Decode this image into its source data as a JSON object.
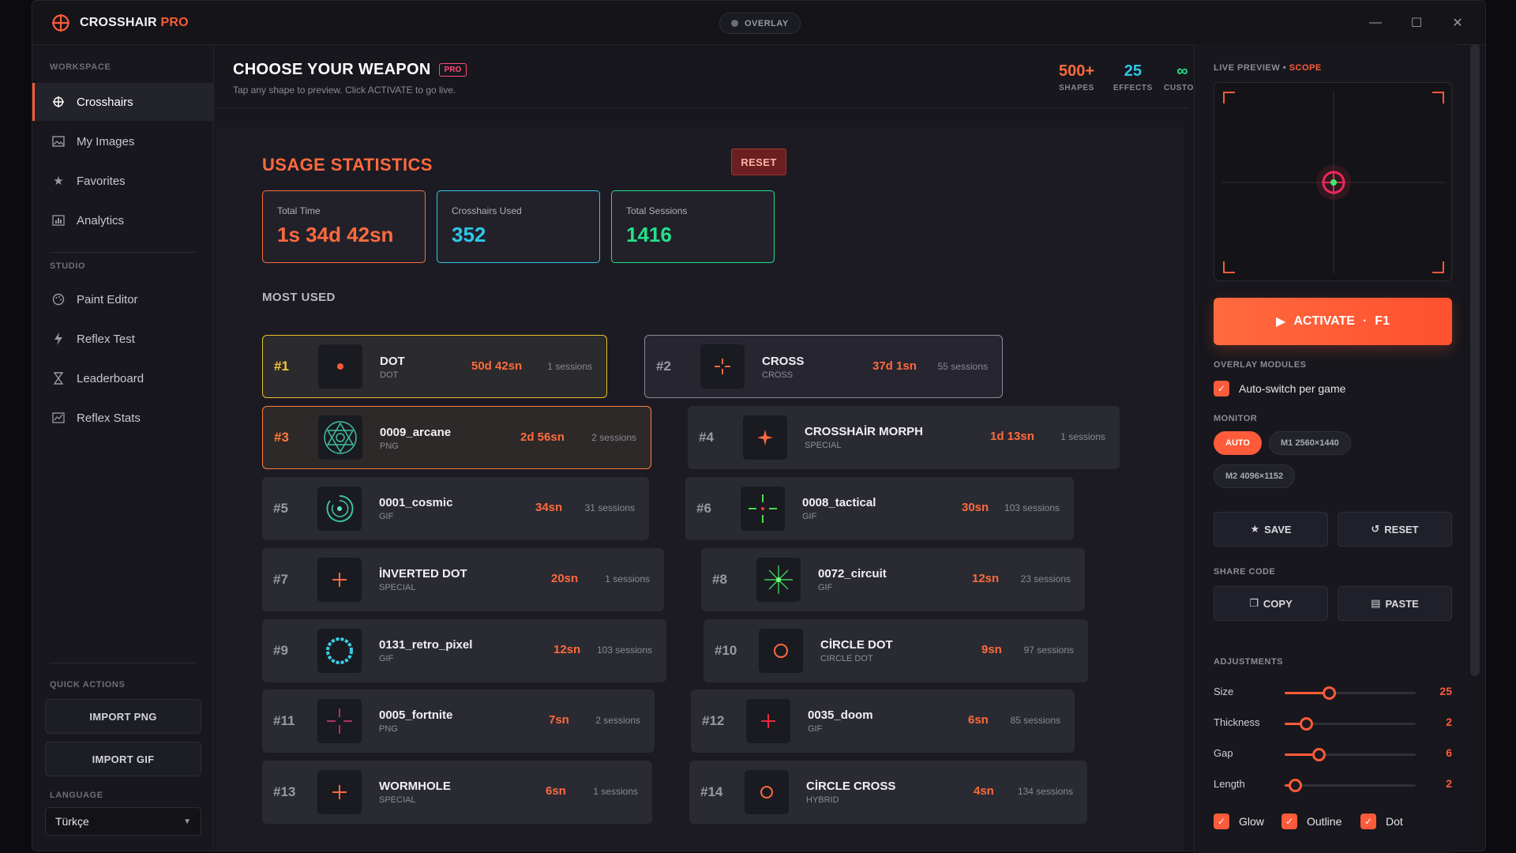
{
  "app": {
    "name": "CROSSHAIR",
    "name_accent": "PRO",
    "overlay_label": "OVERLAY"
  },
  "sidebar": {
    "workspace_label": "WORKSPACE",
    "workspace_items": [
      {
        "label": "Crosshairs",
        "icon": "crosshair-icon"
      },
      {
        "label": "My Images",
        "icon": "image-icon"
      },
      {
        "label": "Favorites",
        "icon": "star-icon"
      },
      {
        "label": "Analytics",
        "icon": "chart-icon"
      }
    ],
    "studio_label": "STUDIO",
    "studio_items": [
      {
        "label": "Paint Editor",
        "icon": "palette-icon"
      },
      {
        "label": "Reflex Test",
        "icon": "bolt-icon"
      },
      {
        "label": "Leaderboard",
        "icon": "trophy-icon"
      },
      {
        "label": "Reflex Stats",
        "icon": "stats-icon"
      }
    ],
    "quick_actions_label": "QUICK ACTIONS",
    "import_png": "IMPORT PNG",
    "import_gif": "IMPORT GIF",
    "language_label": "LANGUAGE",
    "language_value": "Türkçe"
  },
  "header": {
    "title": "CHOOSE YOUR WEAPON",
    "badge": "PRO",
    "subtitle": "Tap any shape to preview. Click ACTIVATE to go live.",
    "stats": [
      {
        "value": "500+",
        "label": "SHAPES",
        "color": "#ff6a3d"
      },
      {
        "value": "25",
        "label": "EFFECTS",
        "color": "#2fc8e8"
      },
      {
        "value": "∞",
        "label": "CUSTOM",
        "color": "#25e08a"
      }
    ]
  },
  "usage": {
    "title": "USAGE STATISTICS",
    "reset": "RESET",
    "cards": [
      {
        "label": "Total Time",
        "value": "1s 34d 42sn",
        "color": "#ff6a3d"
      },
      {
        "label": "Crosshairs Used",
        "value": "352",
        "color": "#2fc8e8"
      },
      {
        "label": "Total Sessions",
        "value": "1416",
        "color": "#25e08a"
      }
    ],
    "most_used_label": "MOST USED",
    "items": [
      {
        "rank": "#1",
        "name": "DOT",
        "type": "DOT",
        "time": "50d 42sn",
        "sessions": "1 sessions"
      },
      {
        "rank": "#2",
        "name": "CROSS",
        "type": "CROSS",
        "time": "37d 1sn",
        "sessions": "55 sessions"
      },
      {
        "rank": "#3",
        "name": "0009_arcane",
        "type": "PNG",
        "time": "2d 56sn",
        "sessions": "2 sessions"
      },
      {
        "rank": "#4",
        "name": "CROSSHAİR MORPH",
        "type": "SPECIAL",
        "time": "1d 13sn",
        "sessions": "1 sessions"
      },
      {
        "rank": "#5",
        "name": "0001_cosmic",
        "type": "GIF",
        "time": "34sn",
        "sessions": "31 sessions"
      },
      {
        "rank": "#6",
        "name": "0008_tactical",
        "type": "GIF",
        "time": "30sn",
        "sessions": "103 sessions"
      },
      {
        "rank": "#7",
        "name": "İNVERTED DOT",
        "type": "SPECIAL",
        "time": "20sn",
        "sessions": "1 sessions"
      },
      {
        "rank": "#8",
        "name": "0072_circuit",
        "type": "GIF",
        "time": "12sn",
        "sessions": "23 sessions"
      },
      {
        "rank": "#9",
        "name": "0131_retro_pixel",
        "type": "GIF",
        "time": "12sn",
        "sessions": "103 sessions"
      },
      {
        "rank": "#10",
        "name": "CİRCLE DOT",
        "type": "CIRCLE DOT",
        "time": "9sn",
        "sessions": "97 sessions"
      },
      {
        "rank": "#11",
        "name": "0005_fortnite",
        "type": "PNG",
        "time": "7sn",
        "sessions": "2 sessions"
      },
      {
        "rank": "#12",
        "name": "0035_doom",
        "type": "GIF",
        "time": "6sn",
        "sessions": "85 sessions"
      },
      {
        "rank": "#13",
        "name": "WORMHOLE",
        "type": "SPECIAL",
        "time": "6sn",
        "sessions": "1 sessions"
      },
      {
        "rank": "#14",
        "name": "CİRCLE CROSS",
        "type": "HYBRID",
        "time": "4sn",
        "sessions": "134 sessions"
      }
    ]
  },
  "right": {
    "preview_label": "LIVE PREVIEW",
    "preview_mode": "SCOPE",
    "activate_label": "ACTIVATE",
    "activate_key": "F1",
    "modules_label": "OVERLAY MODULES",
    "auto_switch": "Auto-switch per game",
    "monitor_label": "MONITOR",
    "monitors": [
      {
        "label": "AUTO",
        "selected": true
      },
      {
        "label": "M1  2560×1440",
        "selected": false
      },
      {
        "label": "M2  4096×1152",
        "selected": false
      }
    ],
    "save": "SAVE",
    "reset": "RESET",
    "share_label": "SHARE CODE",
    "copy": "COPY",
    "paste": "PASTE",
    "adjustments_label": "ADJUSTMENTS",
    "sliders": [
      {
        "label": "Size",
        "value": "25",
        "fraction": 0.34
      },
      {
        "label": "Thickness",
        "value": "2",
        "fraction": 0.16
      },
      {
        "label": "Gap",
        "value": "6",
        "fraction": 0.26
      },
      {
        "label": "Length",
        "value": "2",
        "fraction": 0.08
      }
    ],
    "toggles": [
      "Glow",
      "Outline",
      "Dot"
    ]
  }
}
